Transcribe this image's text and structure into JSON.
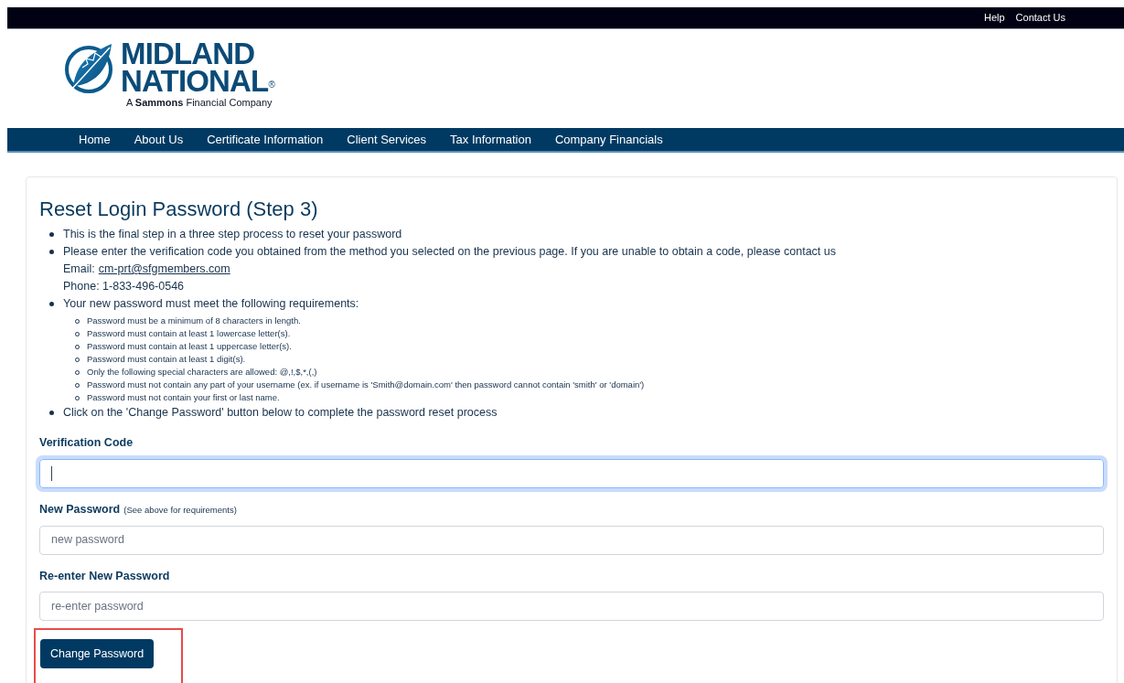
{
  "top_bar": {
    "links": [
      "Help",
      "Contact Us"
    ]
  },
  "logo": {
    "line_1": "MIDLAND",
    "line_2": "NATIONAL",
    "mark": "®",
    "tagline": "A **Sammons** Financial Company"
  },
  "nav": [
    "Home",
    "About Us",
    "Certificate Information",
    "Client Services",
    "Tax Information",
    "Company Financials"
  ],
  "title": "Reset Login Password (Step 3)",
  "steps": [
    {
      "text": "This is the final step in a three step process to reset your password"
    },
    {
      "text": "Please enter the verification code you obtained from the method you selected on the previous page. If you are unable to obtain a code, please contact us",
      "email_label": "Email:",
      "email": "cm-prt@sfgmembers.com",
      "phone": "Phone: 1-833-496-0546"
    },
    {
      "text": "Your new password must meet the following requirements:",
      "children": [
        "Password must be a minimum of 8 characters in length.",
        "Password must contain at least 1 lowercase letter(s).",
        "Password must contain at least 1 uppercase letter(s).",
        "Password must contain at least 1 digit(s).",
        "Only the following special characters are allowed: @,!,$,*,(,)",
        "Password must not contain any part of your username (ex. if username is 'Smith@domain.com' then password cannot contain 'smith' or 'domain')",
        "Password must not contain your first or last name."
      ]
    },
    {
      "text": "Click on the 'Change Password' button below to complete the password reset process"
    }
  ],
  "fields": [
    {
      "label": "Verification Code",
      "focused": true
    },
    {
      "label": "New Password",
      "hint": "(See above for requirements)",
      "placeholder": "new password",
      "focused": false
    },
    {
      "label": "Re-enter New Password",
      "placeholder": "re-enter password",
      "focused": false
    }
  ],
  "submit": {
    "label": "Change Password",
    "highlighted": true
  }
}
